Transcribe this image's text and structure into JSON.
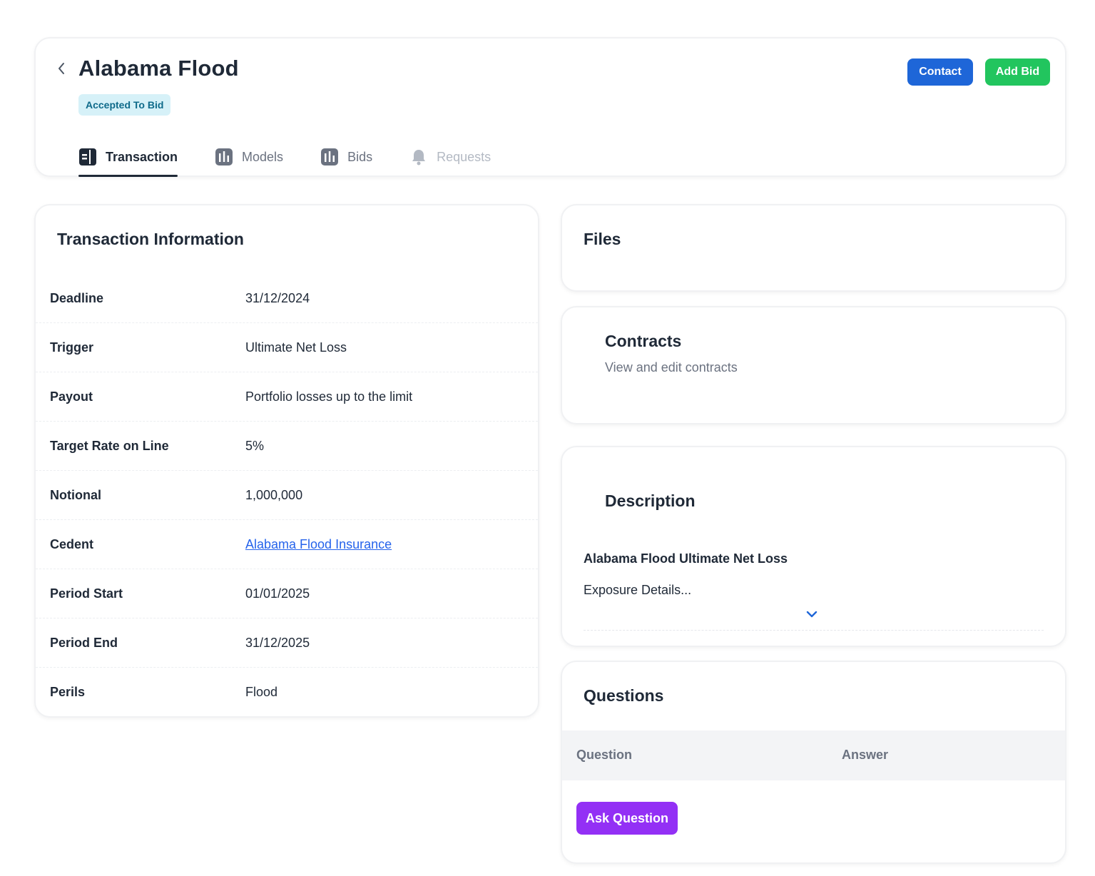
{
  "header": {
    "title": "Alabama Flood",
    "status": "Accepted To Bid",
    "contact_label": "Contact",
    "add_bid_label": "Add Bid",
    "tabs": [
      {
        "label": "Transaction",
        "icon": "transaction-icon",
        "state": "active"
      },
      {
        "label": "Models",
        "icon": "bar-chart-icon",
        "state": "normal"
      },
      {
        "label": "Bids",
        "icon": "bar-chart-icon",
        "state": "normal"
      },
      {
        "label": "Requests",
        "icon": "bell-icon",
        "state": "disabled"
      }
    ]
  },
  "transaction_info": {
    "title": "Transaction Information",
    "rows": [
      {
        "label": "Deadline",
        "value": "31/12/2024"
      },
      {
        "label": "Trigger",
        "value": "Ultimate Net Loss"
      },
      {
        "label": "Payout",
        "value": "Portfolio losses up to the limit"
      },
      {
        "label": "Target Rate on Line",
        "value": "5%"
      },
      {
        "label": "Notional",
        "value": "1,000,000"
      },
      {
        "label": "Cedent",
        "value": "Alabama Flood Insurance"
      },
      {
        "label": "Period Start",
        "value": "01/01/2025"
      },
      {
        "label": "Period End",
        "value": "31/12/2025"
      },
      {
        "label": "Perils",
        "value": "Flood"
      }
    ]
  },
  "files": {
    "title": "Files"
  },
  "contracts": {
    "title": "Contracts",
    "subtitle": "View and edit contracts"
  },
  "description": {
    "title": "Description",
    "heading": "Alabama Flood Ultimate Net Loss",
    "text": "Exposure Details..."
  },
  "questions": {
    "title": "Questions",
    "columns": [
      "Question",
      "Answer"
    ],
    "ask_label": "Ask Question"
  },
  "colors": {
    "contact": "#1e66d8",
    "add_bid": "#22c55e",
    "ask_question": "#9330f5",
    "badge_bg": "#d6f1f8",
    "link": "#2563eb"
  }
}
